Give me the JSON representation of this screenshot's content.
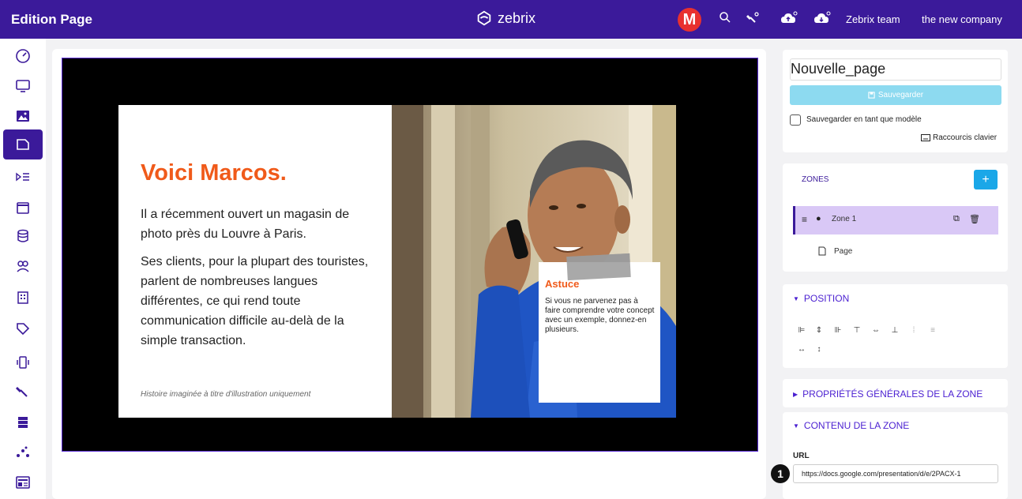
{
  "topbar": {
    "title": "Edition Page",
    "brand": "zebrix",
    "avatar_letter": "M",
    "team_link": "Zebrix team",
    "company_link": "the new company"
  },
  "sidebar": {
    "items": [
      {
        "icon": "dashboard-icon"
      },
      {
        "icon": "monitor-icon"
      },
      {
        "icon": "image-icon"
      },
      {
        "icon": "page-icon",
        "active": true
      },
      {
        "icon": "playlist-icon"
      },
      {
        "icon": "calendar-icon"
      },
      {
        "icon": "database-icon"
      },
      {
        "icon": "users-icon"
      },
      {
        "icon": "building-icon"
      },
      {
        "icon": "tag-icon"
      },
      {
        "icon": "device-icon"
      },
      {
        "icon": "tools-icon"
      },
      {
        "icon": "server-icon"
      },
      {
        "icon": "network-icon"
      },
      {
        "icon": "news-icon"
      }
    ]
  },
  "slide": {
    "title": "Voici Marcos.",
    "paragraph1": "Il a récemment ouvert un magasin de photo près du Louvre à Paris.",
    "paragraph2": "Ses clients, pour la plupart des touristes, parlent de nombreuses langues différentes, ce qui rend toute communication difficile au-delà de la simple transaction.",
    "footnote": "Histoire imaginée à titre d'illustration uniquement",
    "tip_title": "Astuce",
    "tip_text": "Si vous ne parvenez pas à faire comprendre votre concept avec un exemple, donnez-en plusieurs."
  },
  "right_panel": {
    "page_name": "Nouvelle_page",
    "save_label": "Sauvegarder",
    "template_label": "Sauvegarder en tant que modèle",
    "shortcuts_label": "Raccourcis clavier",
    "zones_title": "ZONES",
    "add_label": "+",
    "zone_name": "Zone 1",
    "page_label": "Page",
    "position_title": "POSITION",
    "general_props_title": "PROPRIÉTÉS GÉNÉRALES DE LA ZONE",
    "content_title": "CONTENU DE LA ZONE",
    "url_label": "URL",
    "url_value": "https://docs.google.com/presentation/d/e/2PACX-1",
    "step_number": "1"
  },
  "colors": {
    "brand": "#3b1a9a",
    "accent_orange": "#f05a1a",
    "add_button": "#1aa7e8",
    "save_button": "#8ddaf0",
    "zone_highlight": "#d9c8f6"
  }
}
